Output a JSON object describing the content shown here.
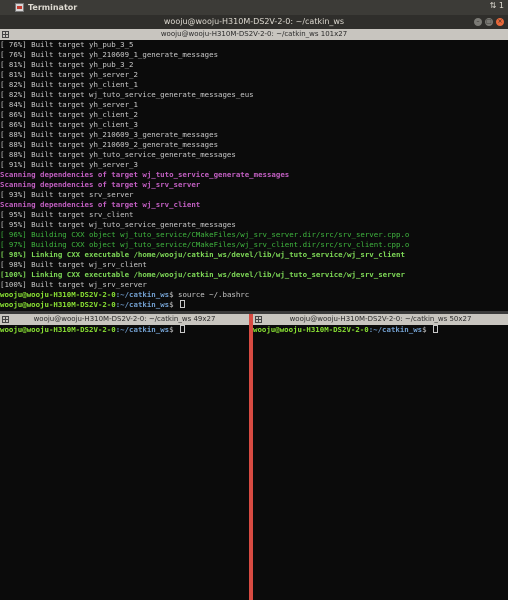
{
  "topbar": {
    "app_name": "Terminator",
    "tray_text": "⇅ 1"
  },
  "window": {
    "title": "wooju@wooju-H310M-DS2V-2-0: ~/catkin_ws"
  },
  "main_pane": {
    "header": "wooju@wooju-H310M-DS2V-2-0: ~/catkin_ws 101x27",
    "lines": [
      {
        "style": "normal",
        "text": "[ 76%] Built target yh_pub_3_5"
      },
      {
        "style": "normal",
        "text": "[ 76%] Built target yh_210609_1_generate_messages"
      },
      {
        "style": "normal",
        "text": "[ 81%] Built target yh_pub_3_2"
      },
      {
        "style": "normal",
        "text": "[ 81%] Built target yh_server_2"
      },
      {
        "style": "normal",
        "text": "[ 82%] Built target yh_client_1"
      },
      {
        "style": "normal",
        "text": "[ 82%] Built target wj_tuto_service_generate_messages_eus"
      },
      {
        "style": "normal",
        "text": "[ 84%] Built target yh_server_1"
      },
      {
        "style": "normal",
        "text": "[ 86%] Built target yh_client_2"
      },
      {
        "style": "normal",
        "text": "[ 86%] Built target yh_client_3"
      },
      {
        "style": "normal",
        "text": "[ 88%] Built target yh_210609_3_generate_messages"
      },
      {
        "style": "normal",
        "text": "[ 88%] Built target yh_210609_2_generate_messages"
      },
      {
        "style": "normal",
        "text": "[ 88%] Built target yh_tuto_service_generate_messages"
      },
      {
        "style": "normal",
        "text": "[ 91%] Built target yh_server_3"
      },
      {
        "style": "magenta",
        "text": "Scanning dependencies of target wj_tuto_service_generate_messages"
      },
      {
        "style": "magenta",
        "text": "Scanning dependencies of target wj_srv_server"
      },
      {
        "style": "normal",
        "text": "[ 93%] Built target srv_server"
      },
      {
        "style": "magenta",
        "text": "Scanning dependencies of target wj_srv_client"
      },
      {
        "style": "normal",
        "text": "[ 95%] Built target srv_client"
      },
      {
        "style": "normal",
        "text": "[ 95%] Built target wj_tuto_service_generate_messages"
      },
      {
        "style": "green",
        "text": "[ 96%] Building CXX object wj_tuto_service/CMakeFiles/wj_srv_server.dir/src/srv_server.cpp.o"
      },
      {
        "style": "green",
        "text": "[ 97%] Building CXX object wj_tuto_service/CMakeFiles/wj_srv_client.dir/src/srv_client.cpp.o"
      },
      {
        "style": "green-bold",
        "text": "[ 98%] Linking CXX executable /home/wooju/catkin_ws/devel/lib/wj_tuto_service/wj_srv_client"
      },
      {
        "style": "normal",
        "text": "[ 98%] Built target wj_srv_client"
      },
      {
        "style": "green-bold",
        "text": "[100%] Linking CXX executable /home/wooju/catkin_ws/devel/lib/wj_tuto_service/wj_srv_server"
      },
      {
        "style": "normal",
        "text": "[100%] Built target wj_srv_server"
      }
    ],
    "prompts": [
      {
        "user": "wooju@wooju-H310M-DS2V-2-0",
        "path": ":~/catkin_ws",
        "symbol": "$ ",
        "command": "source ~/.bashrc"
      },
      {
        "user": "wooju@wooju-H310M-DS2V-2-0",
        "path": ":~/catkin_ws",
        "symbol": "$ ",
        "command": ""
      }
    ]
  },
  "left_pane": {
    "header": "wooju@wooju-H310M-DS2V-2-0: ~/catkin_ws 49x27",
    "prompt": {
      "user": "wooju@wooju-H310M-DS2V-2-0",
      "path": ":~/catkin_ws",
      "symbol": "$ "
    }
  },
  "right_pane": {
    "header": "wooju@wooju-H310M-DS2V-2-0: ~/catkin_ws 50x27",
    "prompt": {
      "user": "wooju@wooju-H310M-DS2V-2-0",
      "path": ":~/catkin_ws",
      "symbol": "$ "
    }
  },
  "colors": {
    "terminal_bg": "#0b0b0b",
    "splitter_active": "#d84b42",
    "prompt_user": "#8ae234",
    "prompt_path": "#729fcf",
    "magenta": "#c25fc2",
    "green": "#3fb63f"
  }
}
